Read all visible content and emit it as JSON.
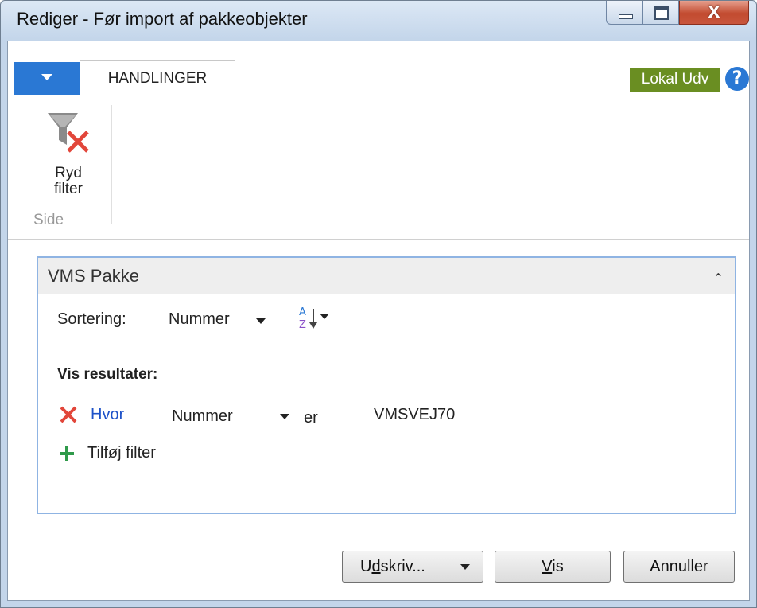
{
  "window": {
    "title": "Rediger - Før import af pakkeobjekter",
    "close_glyph": "X"
  },
  "ribbon": {
    "tab_label": "HANDLINGER",
    "environment_badge": "Lokal Udv",
    "help_glyph": "?",
    "clear_filter_label": "Ryd\nfilter",
    "group_label": "Side"
  },
  "filter_panel": {
    "title": "VMS Pakke",
    "sort_label": "Sortering:",
    "sort_field": "Nummer",
    "results_title": "Vis resultater:",
    "filter_row": {
      "where_label": "Hvor",
      "field": "Nummer",
      "operator": "er",
      "value": "VMSVEJ70"
    },
    "add_filter_label": "Tilføj filter"
  },
  "buttons": {
    "print_pre": "U",
    "print_accel": "d",
    "print_post": "skriv...",
    "show_accel": "V",
    "show_post": "is",
    "cancel": "Annuller"
  },
  "colors": {
    "accent_blue": "#2a78d4",
    "env_green": "#6a8e22",
    "panel_border": "#8fb4e3",
    "link_blue": "#1e52c8",
    "remove_red": "#e2463a",
    "add_green": "#2f9a4a"
  }
}
